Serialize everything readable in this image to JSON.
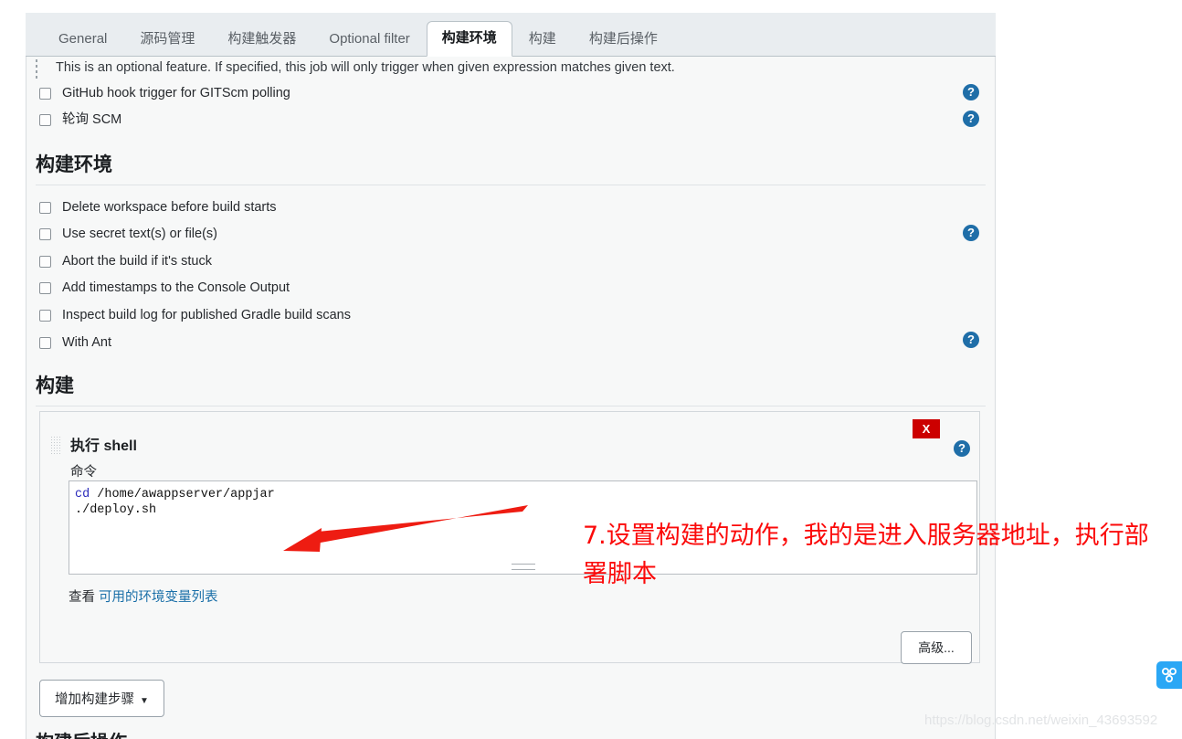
{
  "tabs": [
    {
      "label": "General",
      "active": false
    },
    {
      "label": "源码管理",
      "active": false
    },
    {
      "label": "构建触发器",
      "active": false
    },
    {
      "label": "Optional filter",
      "active": false
    },
    {
      "label": "构建环境",
      "active": true
    },
    {
      "label": "构建",
      "active": false
    },
    {
      "label": "构建后操作",
      "active": false
    }
  ],
  "trigger_section": {
    "note": "This is an optional feature. If specified, this job will only trigger when given expression matches given text.",
    "checkboxes": [
      {
        "label": "GitHub hook trigger for GITScm polling",
        "checked": false,
        "help": true
      },
      {
        "label": "轮询 SCM",
        "checked": false,
        "help": true
      }
    ]
  },
  "build_env_section": {
    "title": "构建环境",
    "checkboxes": [
      {
        "label": "Delete workspace before build starts",
        "checked": false,
        "help": false
      },
      {
        "label": "Use secret text(s) or file(s)",
        "checked": false,
        "help": true
      },
      {
        "label": "Abort the build if it's stuck",
        "checked": false,
        "help": false
      },
      {
        "label": "Add timestamps to the Console Output",
        "checked": false,
        "help": false
      },
      {
        "label": "Inspect build log for published Gradle build scans",
        "checked": false,
        "help": false
      },
      {
        "label": "With Ant",
        "checked": false,
        "help": true
      }
    ]
  },
  "build_section": {
    "title": "构建",
    "step": {
      "title": "执行 shell",
      "delete_label": "X",
      "command_label": "命令",
      "command_value": "cd /home/awappserver/appjar\n./deploy.sh",
      "command_keyword": "cd",
      "command_rest_line1": " /home/awappserver/appjar",
      "command_line2": "./deploy.sh",
      "env_link_prefix": "查看",
      "env_link_text": "可用的环境变量列表",
      "advanced_label": "高级..."
    },
    "add_step_label": "增加构建步骤",
    "add_step_caret": "▼"
  },
  "bottom_partial_heading": "构建后操作",
  "annotation": {
    "text": "7.设置构建的动作，我的是进入服务器地址，执行部署脚本",
    "color": "#fb0a0a"
  },
  "watermark": "https://blog.csdn.net/weixin_43693592",
  "help_icon_glyph": "?",
  "colors": {
    "accent_blue": "#1f6ea8",
    "delete_red": "#cc0000",
    "annotation_red": "#fb0a0a",
    "link_blue": "#1a6fa8",
    "widget_blue": "#2aa7f5"
  }
}
